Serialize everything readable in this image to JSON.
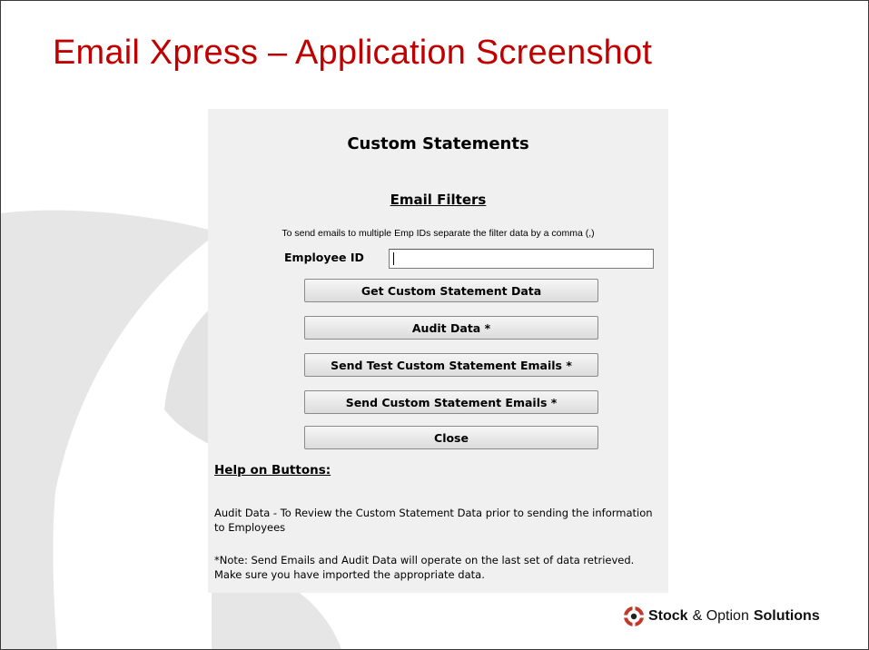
{
  "slide": {
    "title": "Email Xpress – Application Screenshot"
  },
  "dialog": {
    "heading": "Custom Statements",
    "filters_heading": "Email Filters",
    "filters_hint": "To send emails to multiple Emp IDs separate the filter data by a comma (,)",
    "employee_id_label": "Employee ID",
    "employee_id_value": "",
    "buttons": {
      "get_data": "Get Custom Statement Data",
      "audit": "Audit Data *",
      "send_test": "Send Test Custom Statement Emails *",
      "send": "Send Custom Statement Emails *",
      "close": "Close"
    },
    "help": {
      "heading": "Help on Buttons:",
      "audit_text": "Audit Data - To Review the Custom Statement Data prior to sending the information to Employees",
      "note_text": "*Note: Send Emails and Audit Data will operate on the last set of data retrieved.  Make sure you have imported the appropriate data."
    }
  },
  "logo": {
    "word1": "Stock",
    "word2": "& Option",
    "word3": "Solutions",
    "icon": "sos-logo-icon",
    "colors": {
      "red": "#c0392b",
      "dark": "#222222"
    }
  },
  "colors": {
    "title_red": "#c00000",
    "dialog_bg": "#f0f0f0",
    "decor_grey": "#e6e6e6"
  }
}
